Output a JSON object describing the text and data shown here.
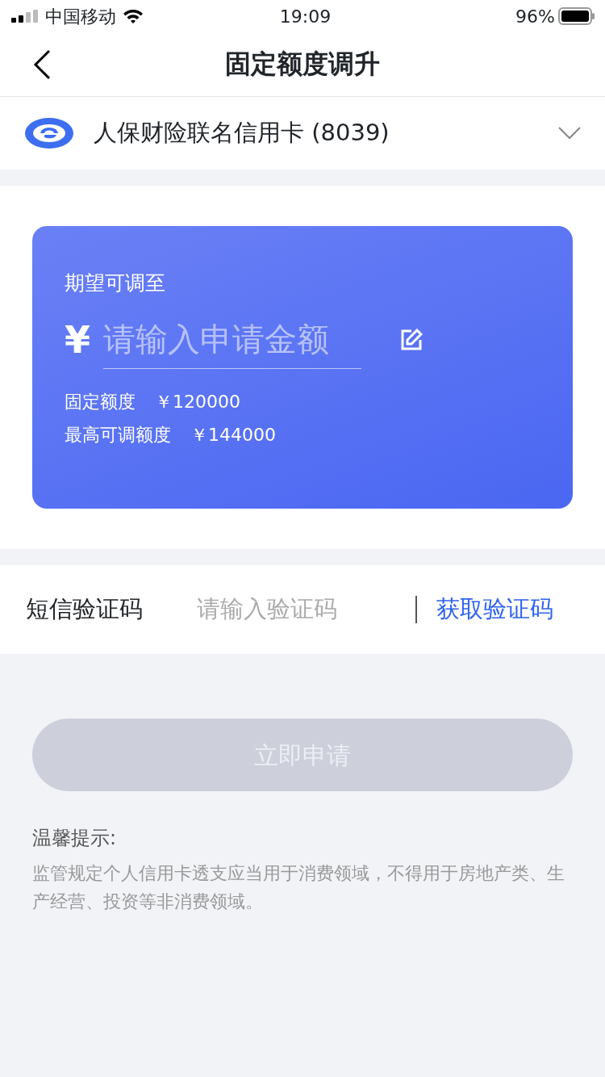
{
  "status_bar": {
    "carrier": "中国移动",
    "time": "19:09",
    "battery": "96%"
  },
  "nav": {
    "title": "固定额度调升"
  },
  "card_select": {
    "name": "人保财险联名信用卡 (8039)"
  },
  "quota_card": {
    "label": "期望可调至",
    "currency": "¥",
    "placeholder": "请输入申请金额",
    "rows": [
      {
        "label": "固定额度",
        "value": "￥120000"
      },
      {
        "label": "最高可调额度",
        "value": "￥144000"
      }
    ]
  },
  "sms": {
    "label": "短信验证码",
    "placeholder": "请输入验证码",
    "action": "获取验证码"
  },
  "submit": {
    "label": "立即申请",
    "disabled": true
  },
  "tips": {
    "title": "温馨提示:",
    "text": "监管规定个人信用卡透支应当用于消费领域，不得用于房地产类、生产经营、投资等非消费领域。"
  }
}
